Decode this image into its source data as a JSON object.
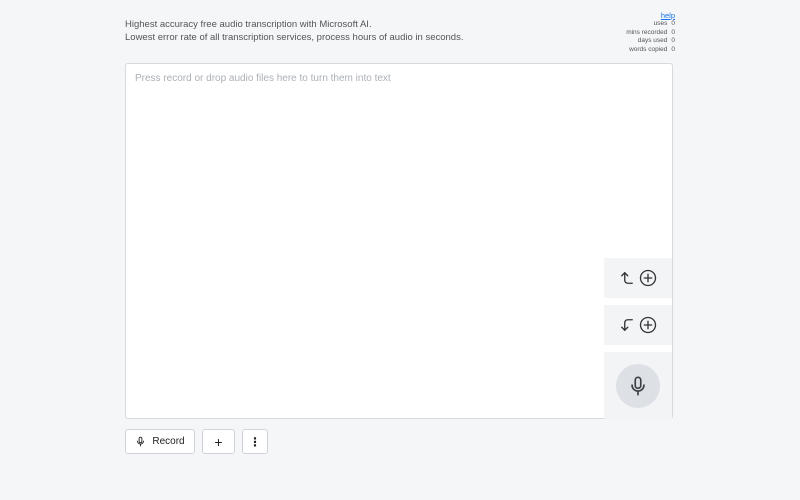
{
  "header": {
    "tagline_line1": "Highest accuracy free audio transcription with Microsoft AI.",
    "tagline_line2": "Lowest error rate of all transcription services, process hours of audio in seconds."
  },
  "stats": {
    "help_label": "help",
    "items": [
      {
        "label": "uses",
        "value": "0"
      },
      {
        "label": "mins recorded",
        "value": "0"
      },
      {
        "label": "days used",
        "value": "0"
      },
      {
        "label": "words copied",
        "value": "0"
      }
    ]
  },
  "editor": {
    "placeholder": "Press record or drop audio files here to turn them into text"
  },
  "side_buttons": {
    "insert_above_icons": [
      "corner-up-arrow-icon",
      "plus-circle-icon"
    ],
    "insert_below_icons": [
      "corner-down-arrow-icon",
      "plus-circle-icon"
    ],
    "mic_icon": "microphone-icon"
  },
  "toolbar": {
    "record_label": "Record",
    "add_label": "+",
    "more_label": "⋮"
  },
  "colors": {
    "background": "#f4f6f8",
    "link": "#1a73e8",
    "border": "#d6d9dd"
  }
}
